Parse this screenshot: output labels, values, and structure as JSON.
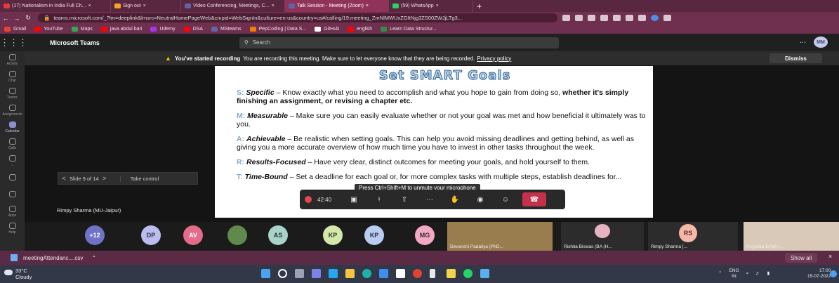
{
  "browser": {
    "tabs": [
      {
        "label": "(17) Nationalism in India Full Ch...",
        "color": "#e33b3b",
        "active": false
      },
      {
        "label": "Sign out",
        "color": "#f4a623",
        "active": false
      },
      {
        "label": "Video Conferencing, Meetings, C...",
        "color": "#6264a7",
        "active": false
      },
      {
        "label": "Talk Session - Meeting (Zoom)",
        "color": "#6264a7",
        "active": true
      },
      {
        "label": "(59) WhatsApp",
        "color": "#25d366",
        "active": false
      }
    ],
    "url": "teams.microsoft.com/_?lm=deeplink&lmsrc=NeutralHomePageWeb&cmpid=WebSignIn&culture=en-us&country=us#/calling/19:meeting_ZmNlMWUxZGItNjg3ZS00ZWJjLTg3...",
    "bookmarks": [
      {
        "label": "Gmail",
        "color": "#ea4335"
      },
      {
        "label": "YouTube",
        "color": "#ff0000"
      },
      {
        "label": "Maps",
        "color": "#34a853"
      },
      {
        "label": "java abdul bari",
        "color": "#ff0000"
      },
      {
        "label": "Udemy",
        "color": "#a435f0"
      },
      {
        "label": "DSA",
        "color": "#ff0000"
      },
      {
        "label": "MSteams",
        "color": "#6264a7"
      },
      {
        "label": "PepCoding | Data S...",
        "color": "#f57c00"
      },
      {
        "label": "GitHub",
        "color": "#ffffff"
      },
      {
        "label": "english",
        "color": "#ff0000"
      },
      {
        "label": "Learn Data Structur...",
        "color": "#2f8d46"
      }
    ]
  },
  "teams": {
    "app_name": "Microsoft Teams",
    "search_placeholder": "Search",
    "more": "...",
    "user_initials": "MM",
    "rail": [
      {
        "label": "Activity",
        "active": false
      },
      {
        "label": "Chat",
        "active": false
      },
      {
        "label": "Teams",
        "active": false
      },
      {
        "label": "Assignments",
        "active": false
      },
      {
        "label": "Calendar",
        "active": true
      },
      {
        "label": "Calls",
        "active": false
      },
      {
        "label": "...",
        "active": false
      },
      {
        "label": "",
        "active": false
      },
      {
        "label": "",
        "active": false
      },
      {
        "label": "Apps",
        "active": false
      },
      {
        "label": "Help",
        "active": false
      }
    ]
  },
  "meeting": {
    "banner": {
      "bold": "You've started recording",
      "text": "You are recording this meeting. Make sure to let everyone know that they are being recorded.",
      "link": "Privacy policy",
      "dismiss": "Dismiss"
    },
    "slide": {
      "title": "Set SMART Goals",
      "items": [
        {
          "key": "S:",
          "term": "Specific",
          "body": " – Know exactly what you need to accomplish and what you hope to gain from doing so, ",
          "bold_tail": "whether it's simply finishing an assignment, or revising a chapter etc."
        },
        {
          "key": "M:",
          "term": "Measurable",
          "body": " – Make sure you can easily evaluate whether or not your goal was met and how beneficial it ultimately was to you.",
          "bold_tail": ""
        },
        {
          "key": "A:",
          "term": "Achievable",
          "body": " – Be realistic when setting goals. This can help you avoid missing deadlines and getting behind, as well as giving you a more accurate overview of how much time you have to invest in other tasks throughout the week.",
          "bold_tail": ""
        },
        {
          "key": "R:",
          "term": "Results-Focused",
          "body": " – Have very clear, distinct outcomes for meeting your goals, and hold yourself to them.",
          "bold_tail": ""
        },
        {
          "key": "T:",
          "term": "Time-Bound",
          "body": " – Set a deadline for each goal or, for more complex tasks with multiple steps, establish deadlines for...",
          "bold_tail": ""
        }
      ]
    },
    "unmute_tip": "Press Ctrl+Shift+M to unmute your microphone",
    "slide_nav": {
      "prev": "<",
      "position": "Slide 9 of 14",
      "next": ">",
      "take_control": "Take control"
    },
    "presenter": "Rimpy Sharma (MU-Jaipur)",
    "timer": "42:40",
    "participants": [
      {
        "initials": "+12",
        "color": "#6f73c8"
      },
      {
        "initials": "DP",
        "color": "#b9bdf0"
      },
      {
        "initials": "AV",
        "color": "#e36b8b"
      },
      {
        "initials": "",
        "color": "#5f8a4c"
      },
      {
        "initials": "AS",
        "color": "#a7d3c9"
      },
      {
        "initials": "KP",
        "color": "#d4e8a8"
      },
      {
        "initials": "KP",
        "color": "#b8cdf2"
      },
      {
        "initials": "MG",
        "color": "#f3a8c4"
      }
    ],
    "video_tiles": [
      {
        "name": "Devanshi Padaliya (PhD..."
      },
      {
        "name": "Rishita Biswas (BA (H..."
      },
      {
        "name": "Rimpy Sharma [..."
      },
      {
        "name": "Priyanka Singh [..."
      }
    ],
    "rs_initials": "RS"
  },
  "downloads": {
    "file": "meetingAttendanc....csv",
    "show_all": "Show all",
    "close": "×"
  },
  "taskbar": {
    "weather_temp": "33°C",
    "weather_desc": "Cloudy",
    "lang1": "ENG",
    "lang2": "IN",
    "time": "17:00",
    "date": "15-07-2022"
  }
}
